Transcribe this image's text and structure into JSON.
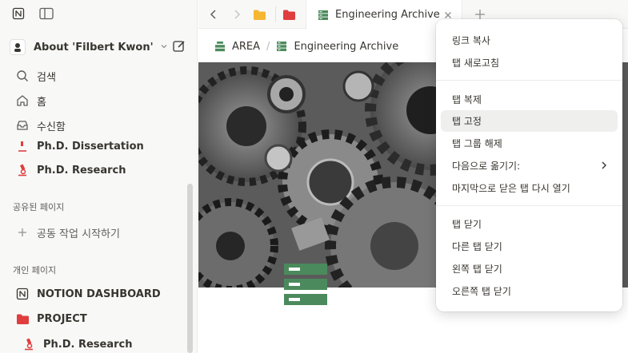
{
  "sidebar": {
    "workspace_name": "About 'Filbert Kwon'",
    "nav": [
      {
        "label": "검색",
        "icon": "search-icon"
      },
      {
        "label": "홈",
        "icon": "home-icon"
      },
      {
        "label": "수신함",
        "icon": "inbox-icon"
      }
    ],
    "partial_item": "Ph.D. Dissertation",
    "research_item": "Ph.D. Research",
    "shared_section": "공유된 페이지",
    "shared_add": "공동 작업 시작하기",
    "private_section": "개인 페이지",
    "private_items": [
      {
        "label": "NOTION DASHBOARD",
        "icon": "notion-logo-icon"
      },
      {
        "label": "PROJECT",
        "icon": "folder-icon"
      },
      {
        "label": "Ph.D. Research",
        "icon": "microscope-icon"
      }
    ]
  },
  "tabbar": {
    "active_tab": "Engineering Archive"
  },
  "breadcrumb": {
    "items": [
      "AREA",
      "Engineering Archive"
    ]
  },
  "context_menu": {
    "groups": [
      [
        "링크 복사",
        "탭 새로고침"
      ],
      [
        "탭 복제",
        "탭 고정",
        "탭 그룹 해제",
        "다음으로 옮기기:",
        "마지막으로 닫은 탭 다시 열기"
      ],
      [
        "탭 닫기",
        "다른 탭 닫기",
        "왼쪽 탭 닫기",
        "오른쪽 탭 닫기"
      ]
    ],
    "hovered_item": "탭 고정"
  },
  "colors": {
    "accent_green": "#4b8a5c",
    "folder_red": "#e03e3e",
    "folder_yellow": "#f5b731"
  }
}
